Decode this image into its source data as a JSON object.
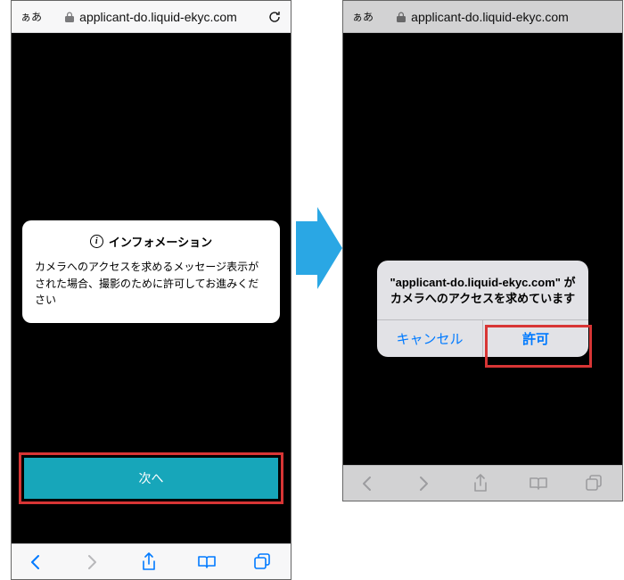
{
  "left_phone": {
    "urlbar": {
      "aa": "ぁあ",
      "domain": "applicant-do.liquid-ekyc.com"
    },
    "info_card": {
      "title": "インフォメーション",
      "body": "カメラへのアクセスを求めるメッセージ表示がされた場合、撮影のために許可してお進みください"
    },
    "next_button": "次へ"
  },
  "right_phone": {
    "urlbar": {
      "aa": "ぁあ",
      "domain": "applicant-do.liquid-ekyc.com"
    },
    "alert": {
      "message": "\"applicant-do.liquid-ekyc.com\" がカメラへのアクセスを求めています",
      "cancel": "キャンセル",
      "allow": "許可"
    }
  },
  "icons": {
    "lock": "lock-icon",
    "reload": "reload-icon",
    "back": "back-icon",
    "forward": "forward-icon",
    "share": "share-icon",
    "bookmarks": "bookmarks-icon",
    "tabs": "tabs-icon",
    "info": "info-icon",
    "arrow": "arrow-icon"
  },
  "highlight_color": "#d83535"
}
